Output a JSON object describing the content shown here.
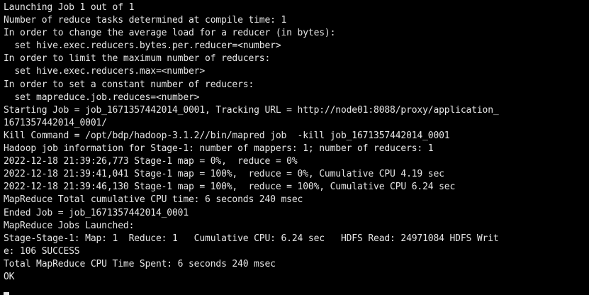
{
  "terminal": {
    "lines": [
      "Launching Job 1 out of 1",
      "Number of reduce tasks determined at compile time: 1",
      "In order to change the average load for a reducer (in bytes):",
      "  set hive.exec.reducers.bytes.per.reducer=<number>",
      "In order to limit the maximum number of reducers:",
      "  set hive.exec.reducers.max=<number>",
      "In order to set a constant number of reducers:",
      "  set mapreduce.job.reduces=<number>",
      "Starting Job = job_1671357442014_0001, Tracking URL = http://node01:8088/proxy/application_",
      "1671357442014_0001/",
      "Kill Command = /opt/bdp/hadoop-3.1.2//bin/mapred job  -kill job_1671357442014_0001",
      "Hadoop job information for Stage-1: number of mappers: 1; number of reducers: 1",
      "2022-12-18 21:39:26,773 Stage-1 map = 0%,  reduce = 0%",
      "2022-12-18 21:39:41,041 Stage-1 map = 100%,  reduce = 0%, Cumulative CPU 4.19 sec",
      "2022-12-18 21:39:46,130 Stage-1 map = 100%,  reduce = 100%, Cumulative CPU 6.24 sec",
      "MapReduce Total cumulative CPU time: 6 seconds 240 msec",
      "Ended Job = job_1671357442014_0001",
      "MapReduce Jobs Launched:",
      "Stage-Stage-1: Map: 1  Reduce: 1   Cumulative CPU: 6.24 sec   HDFS Read: 24971084 HDFS Writ",
      "e: 106 SUCCESS",
      "Total MapReduce CPU Time Spent: 6 seconds 240 msec",
      "OK"
    ],
    "text_color": "#e6e6e6",
    "background_color": "#000000"
  }
}
